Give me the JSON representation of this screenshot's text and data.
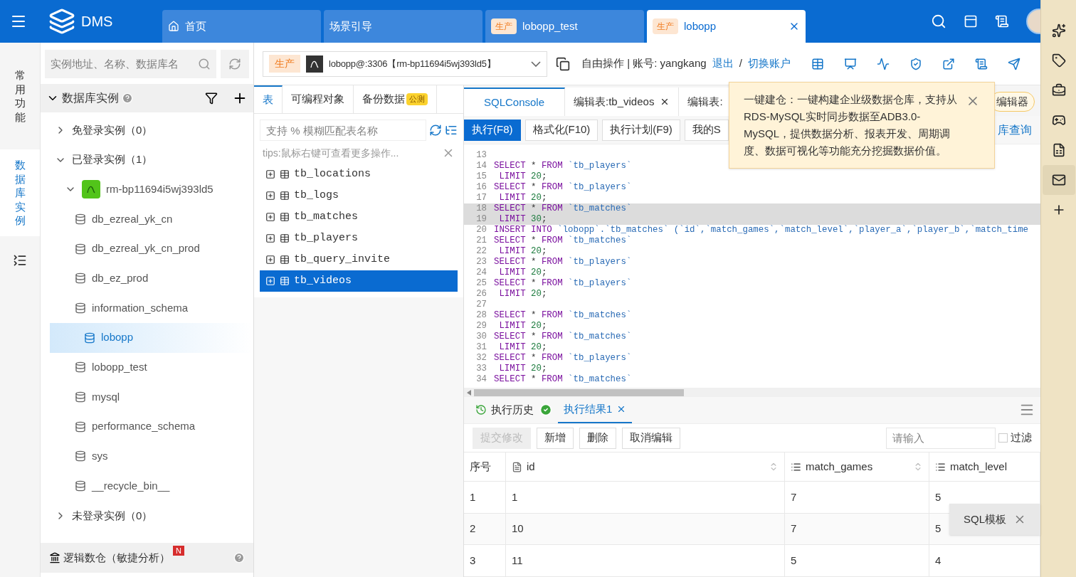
{
  "header": {
    "logo": "DMS",
    "tabs": [
      {
        "kind": "home",
        "label": "首页",
        "selected": false
      },
      {
        "kind": "plain",
        "label": "场景引导",
        "selected": false
      },
      {
        "kind": "env",
        "env": "生产",
        "label": "lobopp_test",
        "selected": false
      },
      {
        "kind": "env",
        "env": "生产",
        "label": "lobopp",
        "selected": true
      }
    ]
  },
  "nav": [
    {
      "label": "常用功能",
      "selected": false
    },
    {
      "label": "数据库实例",
      "selected": true
    }
  ],
  "instance_panel": {
    "search_placeholder": "实例地址、名称、数据库名",
    "title": "数据库实例",
    "tree": [
      {
        "label": "免登录实例（0）",
        "expanded": false
      },
      {
        "label": "已登录实例（1）",
        "expanded": true,
        "children": [
          {
            "label": "rm-bp11694i5wj393ld5",
            "expanded": true,
            "children": [
              {
                "label": "db_ezreal_yk_cn",
                "selected": false
              },
              {
                "label": "db_ezreal_yk_cn_prod",
                "selected": false
              },
              {
                "label": "db_ez_prod",
                "selected": false
              },
              {
                "label": "information_schema",
                "selected": false
              },
              {
                "label": "lobopp",
                "selected": true
              },
              {
                "label": "lobopp_test",
                "selected": false
              },
              {
                "label": "mysql",
                "selected": false
              },
              {
                "label": "performance_schema",
                "selected": false
              },
              {
                "label": "sys",
                "selected": false
              },
              {
                "label": "__recycle_bin__",
                "selected": false
              }
            ]
          }
        ]
      },
      {
        "label": "未登录实例（0）",
        "expanded": false
      }
    ],
    "footer": {
      "label": "逻辑数仓（敏捷分析）",
      "badge": "N"
    }
  },
  "topbar": {
    "env": "生产",
    "instance": "lobopp@:3306【rm-bp11694i5wj393ld5】",
    "mode": "自由操作 | 账号: yangkang",
    "links": [
      "退出",
      "切换账户"
    ],
    "separator": "/"
  },
  "object_panel": {
    "tabs": [
      {
        "label": "表",
        "selected": true
      },
      {
        "label": "可编程对象",
        "selected": false
      },
      {
        "label": "备份数据",
        "badge": "公测",
        "selected": false
      }
    ],
    "search_placeholder": "支持 % 模糊匹配表名称",
    "tips": "tips:鼠标右键可查看更多操作...",
    "tables": [
      {
        "name": "tb_locations",
        "selected": false
      },
      {
        "name": "tb_logs",
        "selected": false
      },
      {
        "name": "tb_matches",
        "selected": false
      },
      {
        "name": "tb_players",
        "selected": false
      },
      {
        "name": "tb_query_invite",
        "selected": false
      },
      {
        "name": "tb_videos",
        "selected": true
      }
    ]
  },
  "editor": {
    "tabs": [
      {
        "label": "SQLConsole",
        "selected": true,
        "closable": false
      },
      {
        "label": "编辑表:tb_videos",
        "selected": false,
        "closable": true
      },
      {
        "label": "编辑表:",
        "selected": false,
        "closable": false
      }
    ],
    "pill": "编辑器",
    "toolbar": [
      {
        "label": "执行(F8)",
        "kind": "primary"
      },
      {
        "label": "格式化(F10)",
        "kind": "default"
      },
      {
        "label": "执行计划(F9)",
        "kind": "default"
      },
      {
        "label": "我的S",
        "kind": "default"
      }
    ],
    "link": "库查询",
    "lines": [
      {
        "n": "13",
        "highlighted": false
      },
      {
        "n": "14",
        "highlighted": false,
        "tokens": [
          {
            "kind": "kw",
            "text": "SELECT"
          },
          {
            "kind": "op",
            "text": " * "
          },
          {
            "kind": "kw",
            "text": "FROM"
          },
          {
            "kind": "id",
            "text": " `tb_players`"
          }
        ]
      },
      {
        "n": "15",
        "highlighted": false,
        "tokens": [
          {
            "kind": "kw",
            "text": " LIMIT "
          },
          {
            "kind": "num",
            "text": "20"
          },
          {
            "kind": "op",
            "text": ";"
          }
        ]
      },
      {
        "n": "16",
        "highlighted": false,
        "tokens": [
          {
            "kind": "kw",
            "text": "SELECT"
          },
          {
            "kind": "op",
            "text": " * "
          },
          {
            "kind": "kw",
            "text": "FROM"
          },
          {
            "kind": "id",
            "text": " `tb_players`"
          }
        ]
      },
      {
        "n": "17",
        "highlighted": false,
        "tokens": [
          {
            "kind": "kw",
            "text": " LIMIT "
          },
          {
            "kind": "num",
            "text": "20"
          },
          {
            "kind": "op",
            "text": ";"
          }
        ]
      },
      {
        "n": "18",
        "highlighted": true,
        "tokens": [
          {
            "kind": "kw",
            "text": "SELECT"
          },
          {
            "kind": "op",
            "text": " * "
          },
          {
            "kind": "kw",
            "text": "FROM"
          },
          {
            "kind": "id",
            "text": " `tb_matches`"
          }
        ]
      },
      {
        "n": "19",
        "highlighted": true,
        "tokens": [
          {
            "kind": "kw",
            "text": " LIMIT "
          },
          {
            "kind": "num",
            "text": "30"
          },
          {
            "kind": "op",
            "text": ";"
          }
        ]
      },
      {
        "n": "20",
        "highlighted": false,
        "tokens": [
          {
            "kind": "kw",
            "text": "INSERT INTO"
          },
          {
            "kind": "id",
            "text": " `lobopp`.`tb_matches` (`id`,`match_games`,`match_level`,`player_a`,`player_b`,`match_time"
          }
        ]
      },
      {
        "n": "21",
        "highlighted": false,
        "tokens": [
          {
            "kind": "kw",
            "text": "SELECT"
          },
          {
            "kind": "op",
            "text": " * "
          },
          {
            "kind": "kw",
            "text": "FROM"
          },
          {
            "kind": "id",
            "text": " `tb_matches`"
          }
        ]
      },
      {
        "n": "22",
        "highlighted": false,
        "tokens": [
          {
            "kind": "kw",
            "text": " LIMIT "
          },
          {
            "kind": "num",
            "text": "20"
          },
          {
            "kind": "op",
            "text": ";"
          }
        ]
      },
      {
        "n": "23",
        "highlighted": false,
        "tokens": [
          {
            "kind": "kw",
            "text": "SELECT"
          },
          {
            "kind": "op",
            "text": " * "
          },
          {
            "kind": "kw",
            "text": "FROM"
          },
          {
            "kind": "id",
            "text": " `tb_players`"
          }
        ]
      },
      {
        "n": "24",
        "highlighted": false,
        "tokens": [
          {
            "kind": "kw",
            "text": " LIMIT "
          },
          {
            "kind": "num",
            "text": "20"
          },
          {
            "kind": "op",
            "text": ";"
          }
        ]
      },
      {
        "n": "25",
        "highlighted": false,
        "tokens": [
          {
            "kind": "kw",
            "text": "SELECT"
          },
          {
            "kind": "op",
            "text": " * "
          },
          {
            "kind": "kw",
            "text": "FROM"
          },
          {
            "kind": "id",
            "text": " `tb_players`"
          }
        ]
      },
      {
        "n": "26",
        "highlighted": false,
        "tokens": [
          {
            "kind": "kw",
            "text": " LIMIT "
          },
          {
            "kind": "num",
            "text": "20"
          },
          {
            "kind": "op",
            "text": ";"
          }
        ]
      },
      {
        "n": "27",
        "highlighted": false
      },
      {
        "n": "28",
        "highlighted": false,
        "tokens": [
          {
            "kind": "kw",
            "text": "SELECT"
          },
          {
            "kind": "op",
            "text": " * "
          },
          {
            "kind": "kw",
            "text": "FROM"
          },
          {
            "kind": "id",
            "text": " `tb_matches`"
          }
        ]
      },
      {
        "n": "29",
        "highlighted": false,
        "tokens": [
          {
            "kind": "kw",
            "text": " LIMIT "
          },
          {
            "kind": "num",
            "text": "20"
          },
          {
            "kind": "op",
            "text": ";"
          }
        ]
      },
      {
        "n": "30",
        "highlighted": false,
        "tokens": [
          {
            "kind": "kw",
            "text": "SELECT"
          },
          {
            "kind": "op",
            "text": " * "
          },
          {
            "kind": "kw",
            "text": "FROM"
          },
          {
            "kind": "id",
            "text": " `tb_matches`"
          }
        ]
      },
      {
        "n": "31",
        "highlighted": false,
        "tokens": [
          {
            "kind": "kw",
            "text": " LIMIT "
          },
          {
            "kind": "num",
            "text": "20"
          },
          {
            "kind": "op",
            "text": ";"
          }
        ]
      },
      {
        "n": "32",
        "highlighted": false,
        "tokens": [
          {
            "kind": "kw",
            "text": "SELECT"
          },
          {
            "kind": "op",
            "text": " * "
          },
          {
            "kind": "kw",
            "text": "FROM"
          },
          {
            "kind": "id",
            "text": " `tb_players`"
          }
        ]
      },
      {
        "n": "33",
        "highlighted": false,
        "tokens": [
          {
            "kind": "kw",
            "text": " LIMIT "
          },
          {
            "kind": "num",
            "text": "20"
          },
          {
            "kind": "op",
            "text": ";"
          }
        ]
      },
      {
        "n": "34",
        "highlighted": false,
        "tokens": [
          {
            "kind": "kw",
            "text": "SELECT"
          },
          {
            "kind": "op",
            "text": " * "
          },
          {
            "kind": "kw",
            "text": "FROM"
          },
          {
            "kind": "id",
            "text": " `tb_matches`"
          }
        ]
      }
    ],
    "tooltip": "一键建仓：一键构建企业级数据仓库，支持从RDS-MySQL实时同步数据至ADB3.0-MySQL，提供数据分析、报表开发、周期调度、数据可视化等功能充分挖掘数据价值。"
  },
  "results": {
    "tabs": [
      {
        "kind": "history",
        "label": "执行历史",
        "selected": false
      },
      {
        "kind": "result",
        "label": "执行结果1",
        "selected": true
      }
    ],
    "toolbar": [
      {
        "label": "提交修改",
        "disabled": true
      },
      {
        "label": "新增",
        "disabled": false
      },
      {
        "label": "删除",
        "disabled": false
      },
      {
        "label": "取消编辑",
        "disabled": false
      }
    ],
    "filter_placeholder": "请输入",
    "filter_checkbox": {
      "label": "过滤",
      "checked": false
    },
    "columns": [
      {
        "kind": "index",
        "label": "序号",
        "sortable": false
      },
      {
        "kind": "text",
        "label": "id",
        "sortable": true
      },
      {
        "kind": "number",
        "label": "match_games",
        "sortable": true
      },
      {
        "kind": "number",
        "label": "match_level",
        "sortable": false
      }
    ],
    "rows": [
      [
        "1",
        "1",
        "7",
        "5"
      ],
      [
        "2",
        "10",
        "7",
        "5"
      ],
      [
        "3",
        "11",
        "5",
        "4"
      ]
    ],
    "template_popup": "SQL模板"
  },
  "browser_sidebar": [
    {
      "kind": "sparkle",
      "selected": false
    },
    {
      "kind": "tag",
      "selected": false
    },
    {
      "kind": "toolbox",
      "selected": false
    },
    {
      "kind": "game",
      "selected": false
    },
    {
      "kind": "office",
      "selected": false
    },
    {
      "kind": "mail",
      "selected": true
    },
    {
      "kind": "add",
      "selected": false
    }
  ]
}
